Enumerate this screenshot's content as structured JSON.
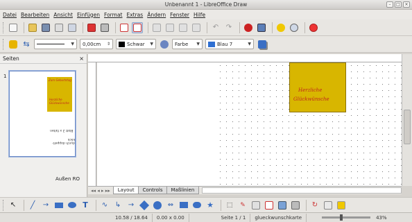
{
  "window": {
    "title": "Unbenannt 1 - LibreOffice Draw"
  },
  "menu": [
    "Datei",
    "Bearbeiten",
    "Ansicht",
    "Einfügen",
    "Format",
    "Extras",
    "Ändern",
    "Fenster",
    "Hilfe"
  ],
  "line_props": {
    "width_value": "0,00cm",
    "line_color_label": "Schwar",
    "area_style_label": "Farbe",
    "area_color_label": "Blau 7"
  },
  "pages_panel": {
    "title": "Seiten",
    "close_glyph": "×",
    "page_number": "1",
    "page_label": "Außen RO"
  },
  "thumbnail": {
    "title_text": "Zum Geburtstag",
    "line1": "Herzliche Glückwünsche",
    "line2": "durch doppelt-klick",
    "line3": "Blatt 2 x falten"
  },
  "page_content": {
    "greeting_line1": "Herzliche",
    "greeting_line2": "Glückwünsche"
  },
  "tabs": [
    {
      "label": "Layout"
    },
    {
      "label": "Controls"
    },
    {
      "label": "Maßlinien"
    }
  ],
  "status": {
    "position": "10.58 / 18.64",
    "size": "0.00 x 0.00",
    "page": "Seite 1 / 1",
    "layout": "glueckwunschkarte",
    "zoom": "43%"
  },
  "colors": {
    "accent": "#3a6fc4",
    "card_gold": "#d8b600",
    "greeting_red": "#c0271d"
  }
}
